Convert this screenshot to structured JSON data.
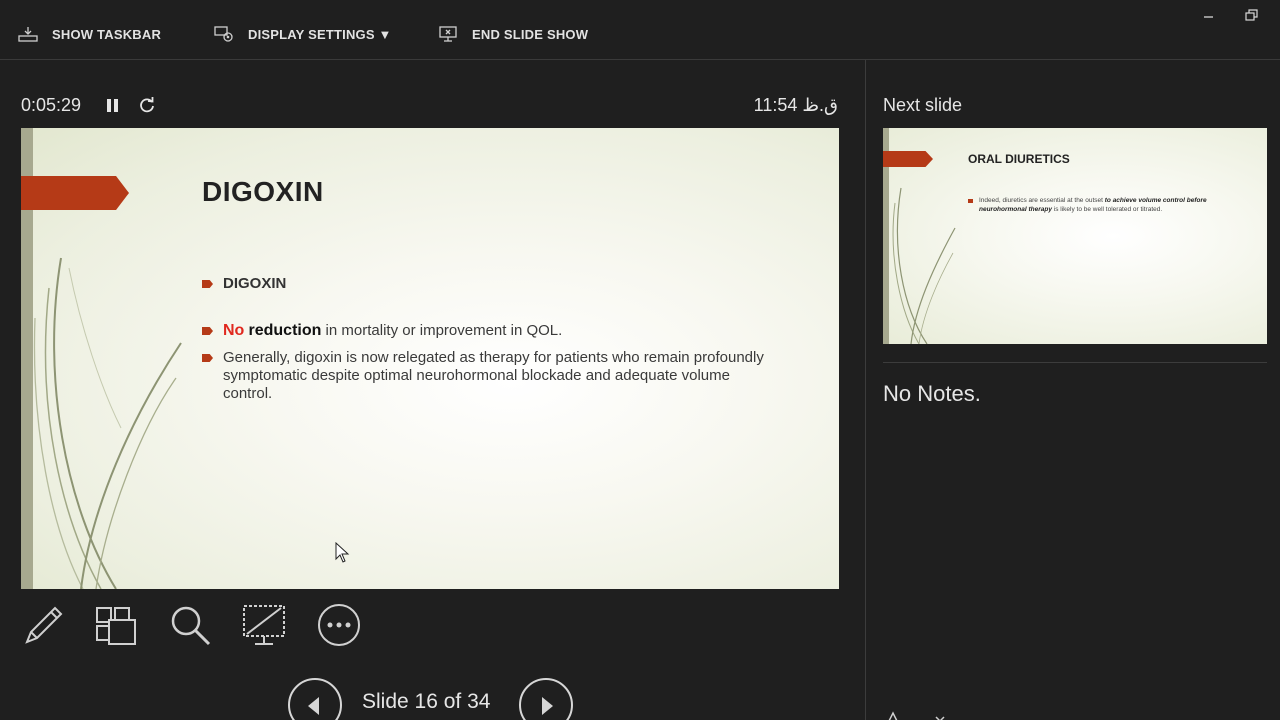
{
  "toolbar": {
    "show_taskbar": "SHOW TASKBAR",
    "display_settings": "DISPLAY SETTINGS ▼",
    "end_slide_show": "END SLIDE SHOW",
    "minimize_icon": "minimize-icon",
    "restore_icon": "restore-icon"
  },
  "timer": {
    "elapsed": "0:05:29",
    "clock": "11:54 ق.ظ"
  },
  "current_slide": {
    "title": "DIGOXIN",
    "bullets": [
      {
        "text": "DIGOXIN"
      },
      {
        "red": "No",
        "strong": "reduction",
        "rest": " in mortality or improvement in QOL."
      },
      {
        "text": "Generally, digoxin is now relegated as therapy for patients who remain profoundly symptomatic despite optimal neurohormonal blockade and adequate volume control."
      }
    ],
    "accent_color": "#b53a17"
  },
  "tools": [
    "pen-tool-icon",
    "see-all-slides-icon",
    "zoom-icon",
    "black-screen-icon",
    "more-options-icon"
  ],
  "navigation": {
    "counter": "Slide 16 of 34",
    "prev_icon": "previous-slide-icon",
    "next_icon": "next-slide-icon"
  },
  "next_slide": {
    "label": "Next slide",
    "title": "ORAL DIURETICS",
    "bullet_plain": "Indeed, diuretics are essential at the outset ",
    "bullet_emph": "to achieve volume control before neurohormonal therapy",
    "bullet_rest": " is likely to be well tolerated or titrated."
  },
  "notes": {
    "text": "No Notes."
  }
}
